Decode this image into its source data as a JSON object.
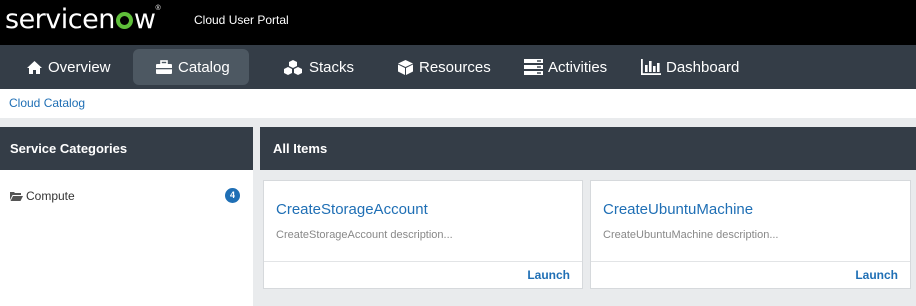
{
  "header": {
    "logo_text_a": "service",
    "logo_text_b": "w",
    "logo_text_n": "n",
    "logo_tm": "®",
    "portal_title": "Cloud User Portal"
  },
  "nav": {
    "items": [
      {
        "label": "Overview",
        "icon": "home-icon"
      },
      {
        "label": "Catalog",
        "icon": "briefcase-icon",
        "active": true
      },
      {
        "label": "Stacks",
        "icon": "cubes-icon"
      },
      {
        "label": "Resources",
        "icon": "cube-icon"
      },
      {
        "label": "Activities",
        "icon": "server-icon"
      },
      {
        "label": "Dashboard",
        "icon": "bar-chart-icon"
      }
    ]
  },
  "breadcrumb": {
    "label": "Cloud Catalog"
  },
  "sidebar": {
    "title": "Service Categories",
    "categories": [
      {
        "label": "Compute",
        "count": "4",
        "icon": "folder-open-icon"
      }
    ]
  },
  "main": {
    "title": "All Items",
    "cards": [
      {
        "title": "CreateStorageAccount",
        "description": "CreateStorageAccount description...",
        "action": "Launch"
      },
      {
        "title": "CreateUbuntuMachine",
        "description": "CreateUbuntuMachine description...",
        "action": "Launch"
      }
    ]
  },
  "colors": {
    "topbar": "#000000",
    "navbar": "#343d47",
    "nav_active": "#4d5862",
    "link": "#1f6fb5",
    "logo_accent": "#5fbf3a",
    "page_bg": "#e9ebed"
  }
}
